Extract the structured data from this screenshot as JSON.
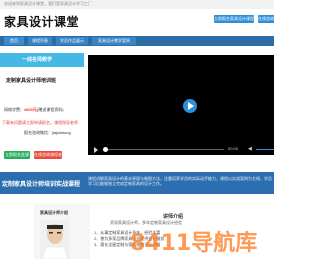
{
  "topbar": {
    "text": "欢迎来到家具设计课堂，我们是家具设计学习工厂"
  },
  "header": {
    "logo": "家具设计课堂",
    "login_label": "立即报名家具设计课程",
    "more_label": "在线咨询"
  },
  "nav": {
    "items": [
      {
        "label": "首页"
      },
      {
        "label": "课程列表"
      },
      {
        "label": "学员作品展示"
      },
      {
        "label": "家具设计教学案例"
      }
    ]
  },
  "course": {
    "banner": "一线名师教学",
    "title": "定制家具设计师培训班",
    "price_prefix": "网络学费：",
    "price": "4800元",
    "price_suffix": "(赠送课程资料)",
    "note": "下载有问题请立即申请报名，课程指导老师",
    "contact_label": "报名咨询微信：",
    "contact_value": "jiajulistong",
    "enroll_button": "立即报名此课程",
    "consult_button": "在线咨询课程老师"
  },
  "video": {
    "time": "00:00",
    "colors": {
      "accent": "#2f8fd6"
    }
  },
  "strip": {
    "title": "定制家具设计师培训实战课程",
    "desc": "课程讲解家具设计的基本原理与制图方法，注重培养学员的实际动手能力，课程以实战案例为主线，学员学习后能够独立完成定制家具的设计工作。"
  },
  "intro": {
    "title": "讲师介绍",
    "subtitle": "资深家具设计师，多年定制家具设计经验",
    "teacher_name": "家具设计师介绍",
    "list": [
      "1、从事定制家具设计多年，经验丰富",
      "2、曾为多家品牌家具企业提供设计服务",
      "3、擅长全屋定制与家具结构设计讲解"
    ]
  },
  "watermark": "8411导航库"
}
